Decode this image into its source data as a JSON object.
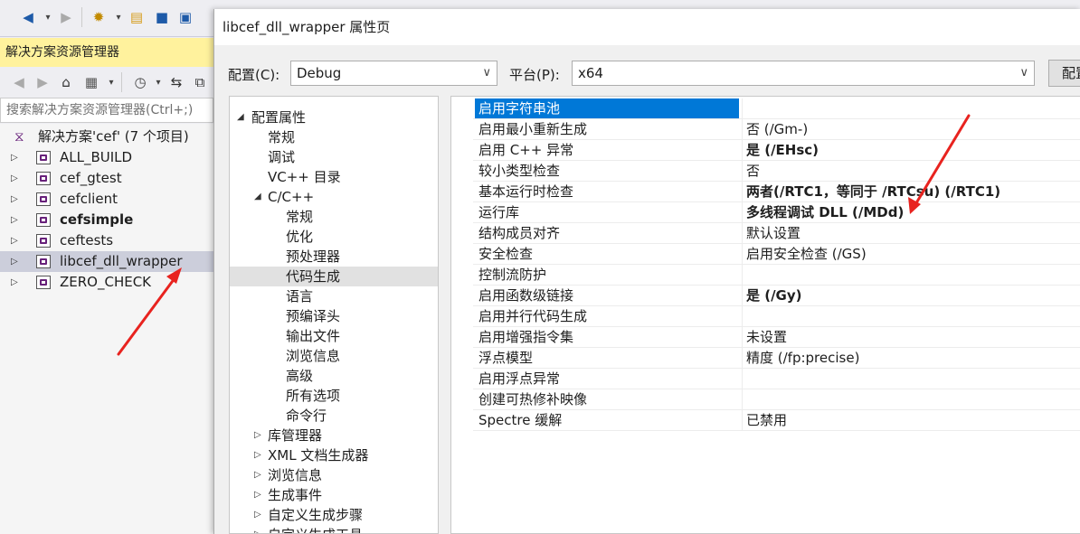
{
  "solution_explorer": {
    "title": "解决方案资源管理器",
    "search_placeholder": "搜索解决方案资源管理器(Ctrl+;)",
    "root_label": "解决方案'cef' (7 个项目)",
    "projects": [
      {
        "label": "ALL_BUILD"
      },
      {
        "label": "cef_gtest"
      },
      {
        "label": "cefclient"
      },
      {
        "label": "cefsimple"
      },
      {
        "label": "ceftests"
      },
      {
        "label": "libcef_dll_wrapper"
      },
      {
        "label": "ZERO_CHECK"
      }
    ]
  },
  "dialog": {
    "title": "libcef_dll_wrapper 属性页",
    "config_label": "配置(C):",
    "config_value": "Debug",
    "platform_label": "平台(P):",
    "platform_value": "x64",
    "config_manager_label": "配置管理器"
  },
  "nav_tree": [
    {
      "label": "配置属性"
    },
    {
      "label": "常规"
    },
    {
      "label": "调试"
    },
    {
      "label": "VC++ 目录"
    },
    {
      "label": "C/C++"
    },
    {
      "label": "常规"
    },
    {
      "label": "优化"
    },
    {
      "label": "预处理器"
    },
    {
      "label": "代码生成"
    },
    {
      "label": "语言"
    },
    {
      "label": "预编译头"
    },
    {
      "label": "输出文件"
    },
    {
      "label": "浏览信息"
    },
    {
      "label": "高级"
    },
    {
      "label": "所有选项"
    },
    {
      "label": "命令行"
    },
    {
      "label": "库管理器"
    },
    {
      "label": "XML 文档生成器"
    },
    {
      "label": "浏览信息"
    },
    {
      "label": "生成事件"
    },
    {
      "label": "自定义生成步骤"
    },
    {
      "label": "自定义生成工具"
    }
  ],
  "properties": [
    {
      "name": "启用字符串池",
      "value": ""
    },
    {
      "name": "启用最小重新生成",
      "value": "否 (/Gm-)"
    },
    {
      "name": "启用 C++ 异常",
      "value": "是 (/EHsc)"
    },
    {
      "name": "较小类型检查",
      "value": "否"
    },
    {
      "name": "基本运行时检查",
      "value": "两者(/RTC1，等同于 /RTCsu) (/RTC1)"
    },
    {
      "name": "运行库",
      "value": "多线程调试 DLL (/MDd)"
    },
    {
      "name": "结构成员对齐",
      "value": "默认设置"
    },
    {
      "name": "安全检查",
      "value": "启用安全检查 (/GS)"
    },
    {
      "name": "控制流防护",
      "value": ""
    },
    {
      "name": "启用函数级链接",
      "value": "是 (/Gy)"
    },
    {
      "name": "启用并行代码生成",
      "value": ""
    },
    {
      "name": "启用增强指令集",
      "value": "未设置"
    },
    {
      "name": "浮点模型",
      "value": "精度 (/fp:precise)"
    },
    {
      "name": "启用浮点异常",
      "value": ""
    },
    {
      "name": "创建可热修补映像",
      "value": ""
    },
    {
      "name": "Spectre 缓解",
      "value": "已禁用"
    }
  ],
  "colors": {
    "selection_blue": "#0078d7",
    "annotation_red": "#e8231f",
    "se_title_yellow": "#fff29d"
  }
}
